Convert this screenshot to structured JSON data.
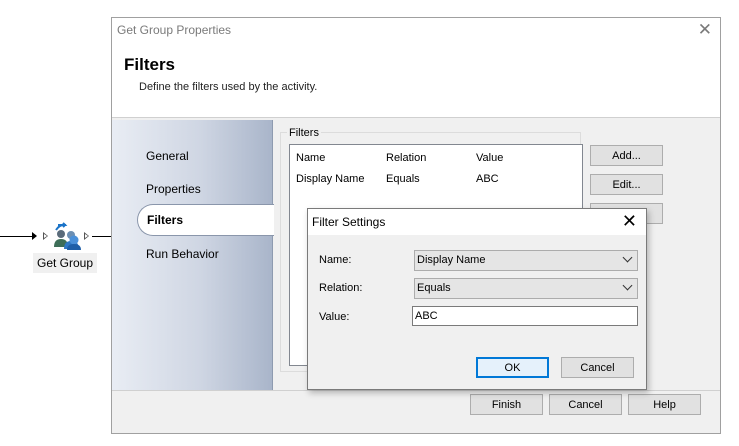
{
  "canvas": {
    "activity_label": "Get Group",
    "activity_icon": "group-users-icon"
  },
  "dialog": {
    "title": "Get Group Properties",
    "heading": "Filters",
    "subtitle": "Define the filters used by the activity.",
    "close_icon": "close-icon",
    "nav": [
      {
        "label": "General"
      },
      {
        "label": "Properties"
      },
      {
        "label": "Filters",
        "selected": true
      },
      {
        "label": "Run Behavior"
      }
    ],
    "filters_group_label": "Filters",
    "columns": [
      "Name",
      "Relation",
      "Value"
    ],
    "rows": [
      [
        "Display Name",
        "Equals",
        "ABC"
      ]
    ],
    "side_buttons": {
      "add": "Add...",
      "edit": "Edit..."
    },
    "footer_buttons": {
      "finish": "Finish",
      "cancel": "Cancel",
      "help": "Help"
    }
  },
  "popup": {
    "title": "Filter Settings",
    "name_label": "Name:",
    "name_value": "Display Name",
    "relation_label": "Relation:",
    "relation_value": "Equals",
    "value_label": "Value:",
    "value_value": "ABC",
    "ok": "OK",
    "cancel": "Cancel"
  },
  "colors": {
    "nav_gradient_start": "#e9edf4",
    "nav_gradient_end": "#a9b5ca",
    "focus_border": "#0078d7"
  }
}
